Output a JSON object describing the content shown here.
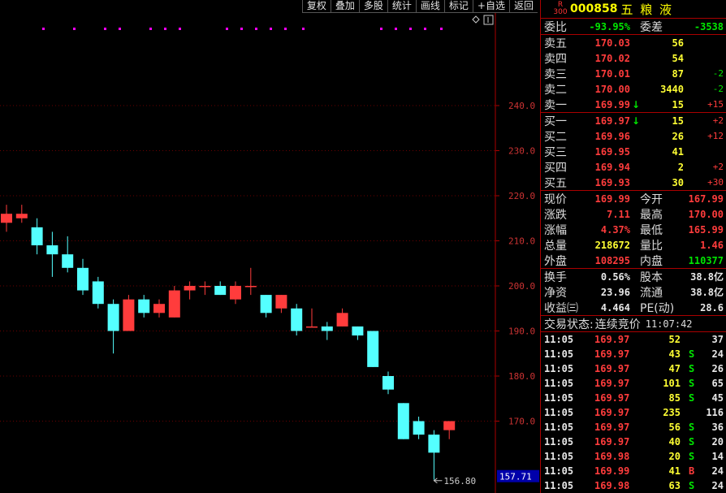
{
  "toolbar": [
    "复权",
    "叠加",
    "多股",
    "统计",
    "画线",
    "标记",
    "+自选",
    "返回"
  ],
  "chart_data": {
    "type": "candlestick",
    "y_ticks": [
      "240.0",
      "230.0",
      "220.0",
      "210.0",
      "200.0",
      "190.0",
      "180.0",
      "170.0"
    ],
    "ylim": [
      155,
      250
    ],
    "current_price_label": "157.71",
    "low_marker_label": "156.80",
    "candles": [
      {
        "o": 216,
        "c": 214,
        "h": 218,
        "l": 212,
        "up": true
      },
      {
        "o": 215,
        "c": 216,
        "h": 218,
        "l": 214,
        "up": true
      },
      {
        "o": 213,
        "c": 209,
        "h": 215,
        "l": 207,
        "up": false
      },
      {
        "o": 209,
        "c": 207,
        "h": 212,
        "l": 202,
        "up": false
      },
      {
        "o": 207,
        "c": 204,
        "h": 211,
        "l": 203,
        "up": false
      },
      {
        "o": 204,
        "c": 199,
        "h": 206,
        "l": 198,
        "up": false
      },
      {
        "o": 201,
        "c": 196,
        "h": 202,
        "l": 195,
        "up": false
      },
      {
        "o": 196,
        "c": 190,
        "h": 197,
        "l": 185,
        "up": false
      },
      {
        "o": 190,
        "c": 197,
        "h": 198,
        "l": 190,
        "up": true
      },
      {
        "o": 197,
        "c": 194,
        "h": 198,
        "l": 193,
        "up": false
      },
      {
        "o": 194,
        "c": 196,
        "h": 197,
        "l": 193,
        "up": true
      },
      {
        "o": 193,
        "c": 199,
        "h": 200,
        "l": 193,
        "up": true
      },
      {
        "o": 199,
        "c": 200,
        "h": 201,
        "l": 197,
        "up": true
      },
      {
        "o": 200,
        "c": 200,
        "h": 201,
        "l": 198,
        "up": true
      },
      {
        "o": 200,
        "c": 198,
        "h": 201,
        "l": 198,
        "up": false
      },
      {
        "o": 197,
        "c": 200,
        "h": 201,
        "l": 196,
        "up": true
      },
      {
        "o": 200,
        "c": 200,
        "h": 204,
        "l": 198,
        "up": true
      },
      {
        "o": 198,
        "c": 194,
        "h": 198,
        "l": 193,
        "up": false
      },
      {
        "o": 195,
        "c": 198,
        "h": 198,
        "l": 194,
        "up": true
      },
      {
        "o": 195,
        "c": 190,
        "h": 196,
        "l": 189,
        "up": false
      },
      {
        "o": 191,
        "c": 191,
        "h": 195,
        "l": 191,
        "up": true
      },
      {
        "o": 191,
        "c": 190,
        "h": 192,
        "l": 188,
        "up": false
      },
      {
        "o": 191,
        "c": 194,
        "h": 195,
        "l": 191,
        "up": true
      },
      {
        "o": 191,
        "c": 189,
        "h": 191,
        "l": 188,
        "up": false
      },
      {
        "o": 190,
        "c": 182,
        "h": 190,
        "l": 182,
        "up": false
      },
      {
        "o": 180,
        "c": 177,
        "h": 181,
        "l": 176,
        "up": false
      },
      {
        "o": 174,
        "c": 166,
        "h": 174,
        "l": 166,
        "up": false
      },
      {
        "o": 170,
        "c": 167,
        "h": 171,
        "l": 166,
        "up": false
      },
      {
        "o": 167,
        "c": 163,
        "h": 168,
        "l": 157,
        "up": false
      },
      {
        "o": 168,
        "c": 170,
        "h": 170,
        "l": 166,
        "up": true
      }
    ]
  },
  "stock": {
    "badge_top": "R",
    "badge_bottom": "300",
    "code": "000858",
    "name": "五 粮 液"
  },
  "weibi": {
    "label": "委比",
    "value": "-93.95%",
    "diff_label": "委差",
    "diff_value": "-3538"
  },
  "sells": [
    {
      "label": "卖五",
      "price": "170.03",
      "vol": "56",
      "chg": "",
      "arrow": ""
    },
    {
      "label": "卖四",
      "price": "170.02",
      "vol": "54",
      "chg": "",
      "arrow": ""
    },
    {
      "label": "卖三",
      "price": "170.01",
      "vol": "87",
      "chg": "-2",
      "arrow": ""
    },
    {
      "label": "卖二",
      "price": "170.00",
      "vol": "3440",
      "chg": "-2",
      "arrow": ""
    },
    {
      "label": "卖一",
      "price": "169.99",
      "vol": "15",
      "chg": "+15",
      "arrow": "↓"
    }
  ],
  "buys": [
    {
      "label": "买一",
      "price": "169.97",
      "vol": "15",
      "chg": "+2",
      "arrow": "↓"
    },
    {
      "label": "买二",
      "price": "169.96",
      "vol": "26",
      "chg": "+12",
      "arrow": ""
    },
    {
      "label": "买三",
      "price": "169.95",
      "vol": "41",
      "chg": "",
      "arrow": ""
    },
    {
      "label": "买四",
      "price": "169.94",
      "vol": "2",
      "chg": "+2",
      "arrow": ""
    },
    {
      "label": "买五",
      "price": "169.93",
      "vol": "30",
      "chg": "+30",
      "arrow": ""
    }
  ],
  "quote": [
    {
      "l1": "现价",
      "v1": "169.99",
      "c1": "red",
      "l2": "今开",
      "v2": "167.99",
      "c2": "red"
    },
    {
      "l1": "涨跌",
      "v1": "7.11",
      "c1": "red",
      "l2": "最高",
      "v2": "170.00",
      "c2": "red"
    },
    {
      "l1": "涨幅",
      "v1": "4.37%",
      "c1": "red",
      "l2": "最低",
      "v2": "165.99",
      "c2": "red"
    },
    {
      "l1": "总量",
      "v1": "218672",
      "c1": "yellow",
      "l2": "量比",
      "v2": "1.46",
      "c2": "red"
    },
    {
      "l1": "外盘",
      "v1": "108295",
      "c1": "red",
      "l2": "内盘",
      "v2": "110377",
      "c2": "green"
    }
  ],
  "fund": [
    {
      "l1": "换手",
      "v1": "0.56%",
      "l2": "股本",
      "v2": "38.8亿"
    },
    {
      "l1": "净资",
      "v1": "23.96",
      "l2": "流通",
      "v2": "38.8亿"
    },
    {
      "l1": "收益㈢",
      "v1": "4.464",
      "l2": "PE(动)",
      "v2": "28.6"
    }
  ],
  "status": {
    "label": "交易状态:",
    "value": "连续竞价",
    "time": "11:07:42"
  },
  "ticks": [
    {
      "t": "11:05",
      "p": "169.97",
      "v": "52",
      "s": "",
      "n": "37"
    },
    {
      "t": "11:05",
      "p": "169.97",
      "v": "43",
      "s": "S",
      "n": "24"
    },
    {
      "t": "11:05",
      "p": "169.97",
      "v": "47",
      "s": "S",
      "n": "26"
    },
    {
      "t": "11:05",
      "p": "169.97",
      "v": "101",
      "s": "S",
      "n": "65"
    },
    {
      "t": "11:05",
      "p": "169.97",
      "v": "85",
      "s": "S",
      "n": "45"
    },
    {
      "t": "11:05",
      "p": "169.97",
      "v": "235",
      "s": "",
      "n": "116"
    },
    {
      "t": "11:05",
      "p": "169.97",
      "v": "56",
      "s": "S",
      "n": "36"
    },
    {
      "t": "11:05",
      "p": "169.97",
      "v": "40",
      "s": "S",
      "n": "20"
    },
    {
      "t": "11:05",
      "p": "169.98",
      "v": "20",
      "s": "S",
      "n": "14"
    },
    {
      "t": "11:05",
      "p": "169.99",
      "v": "41",
      "s": "B",
      "n": "24"
    },
    {
      "t": "11:05",
      "p": "169.98",
      "v": "63",
      "s": "S",
      "n": "24"
    }
  ]
}
